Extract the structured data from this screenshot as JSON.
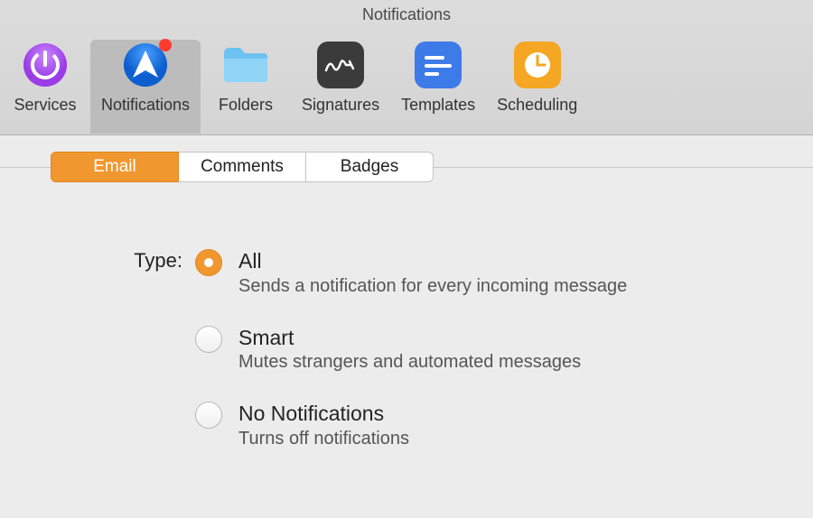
{
  "window": {
    "title": "Notifications"
  },
  "toolbar": {
    "items": [
      {
        "label": "Services"
      },
      {
        "label": "Notifications"
      },
      {
        "label": "Folders"
      },
      {
        "label": "Signatures"
      },
      {
        "label": "Templates"
      },
      {
        "label": "Scheduling"
      }
    ],
    "active_index": 1
  },
  "subtabs": {
    "items": [
      {
        "label": "Email"
      },
      {
        "label": "Comments"
      },
      {
        "label": "Badges"
      }
    ],
    "active_index": 0
  },
  "type_section": {
    "label": "Type:",
    "options": [
      {
        "title": "All",
        "desc": "Sends a notification for every incoming message",
        "selected": true
      },
      {
        "title": "Smart",
        "desc": "Mutes strangers and automated messages",
        "selected": false
      },
      {
        "title": "No Notifications",
        "desc": "Turns off notifications",
        "selected": false
      }
    ]
  }
}
